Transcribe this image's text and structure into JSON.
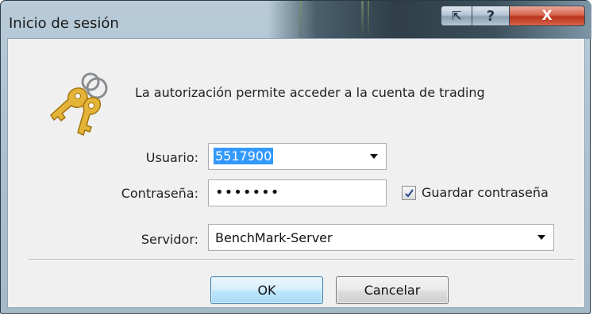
{
  "window": {
    "title": "Inicio de sesión",
    "controls": {
      "restore_glyph": "⇱",
      "help_glyph": "?",
      "close_glyph": "X"
    }
  },
  "dialog": {
    "icon": "keys-icon",
    "message": "La autorización permite acceder a la cuenta de trading",
    "login": {
      "label": "Usuario:",
      "value": "5517900"
    },
    "password": {
      "label": "Contraseña:",
      "value": "•••••••"
    },
    "save_password": {
      "label": "Guardar contraseña",
      "checked": true
    },
    "server": {
      "label": "Servidor:",
      "value": "BenchMark-Server"
    }
  },
  "buttons": {
    "ok": "OK",
    "cancel": "Cancelar"
  },
  "colors": {
    "selection": "#3399ff",
    "close_button": "#c8432b",
    "ok_border": "#3c7fb1"
  }
}
